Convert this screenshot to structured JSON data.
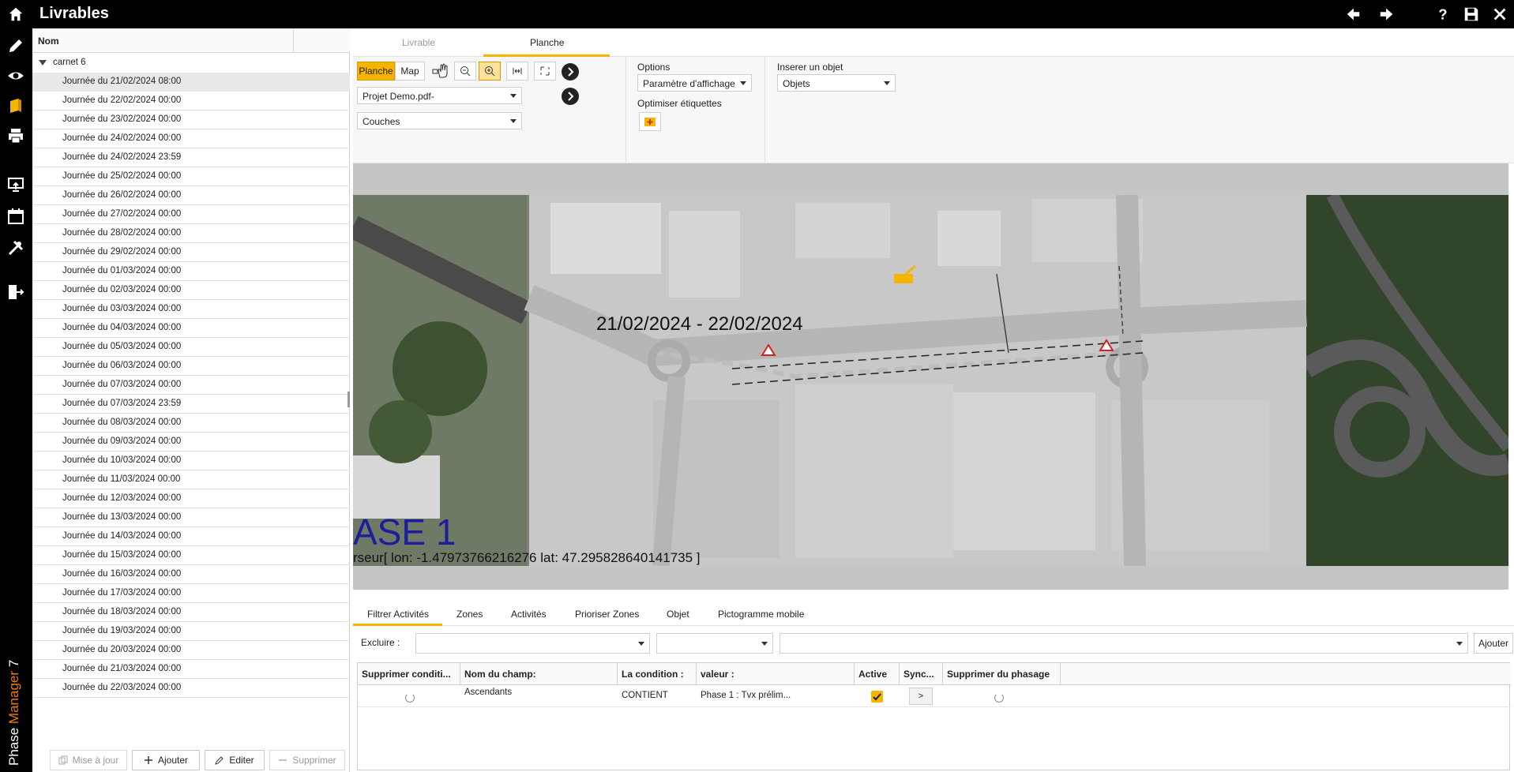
{
  "app": {
    "title": "Livrables",
    "brand_first": "Phase",
    "brand_accent": "Manager",
    "brand_version": "7",
    "accent_color": "#f5b400",
    "brand_color": "#f07a10"
  },
  "topbar_icons": [
    "home-icon",
    "arrow-left-icon",
    "arrow-right-icon",
    "help-icon",
    "save-icon",
    "close-icon"
  ],
  "leftnav_icons": [
    "pencil-icon",
    "eye-icon",
    "book-icon",
    "printer-icon",
    "monitor-upload-icon",
    "calendar-icon",
    "tools-icon",
    "logout-icon"
  ],
  "list": {
    "header": "Nom",
    "group": "carnet 6",
    "rows": [
      "Journée du 21/02/2024 08:00",
      "Journée du 22/02/2024 00:00",
      "Journée du 23/02/2024 00:00",
      "Journée du 24/02/2024 00:00",
      "Journée du 24/02/2024 23:59",
      "Journée du 25/02/2024 00:00",
      "Journée du 26/02/2024 00:00",
      "Journée du 27/02/2024 00:00",
      "Journée du 28/02/2024 00:00",
      "Journée du 29/02/2024 00:00",
      "Journée du 01/03/2024 00:00",
      "Journée du 02/03/2024 00:00",
      "Journée du 03/03/2024 00:00",
      "Journée du 04/03/2024 00:00",
      "Journée du 05/03/2024 00:00",
      "Journée du 06/03/2024 00:00",
      "Journée du 07/03/2024 00:00",
      "Journée du 07/03/2024 23:59",
      "Journée du 08/03/2024 00:00",
      "Journée du 09/03/2024 00:00",
      "Journée du 10/03/2024 00:00",
      "Journée du 11/03/2024 00:00",
      "Journée du 12/03/2024 00:00",
      "Journée du 13/03/2024 00:00",
      "Journée du 14/03/2024 00:00",
      "Journée du 15/03/2024 00:00",
      "Journée du 16/03/2024 00:00",
      "Journée du 17/03/2024 00:00",
      "Journée du 18/03/2024 00:00",
      "Journée du 19/03/2024 00:00",
      "Journée du 20/03/2024 00:00",
      "Journée du 21/03/2024 00:00",
      "Journée du 22/03/2024 00:00"
    ],
    "footer": {
      "update": "Mise à jour",
      "add": "Ajouter",
      "edit": "Editer",
      "delete": "Supprimer"
    }
  },
  "tabs": {
    "livrable": "Livrable",
    "planche": "Planche"
  },
  "toolbar": {
    "planche": "Planche",
    "map": "Map",
    "project": "Projet Demo.pdf-",
    "layers": "Couches",
    "options_label": "Options",
    "options_value": "Paramètre d'affichage",
    "optimise_label": "Optimiser étiquettes",
    "insert_label": "Inserer un objet",
    "insert_value": "Objets"
  },
  "map": {
    "date_range": "21/02/2024  - 22/02/2024",
    "phase_text": "ASE 1",
    "coords_text": "rseur[ lon: -1.47973766216276 lat: 47.295828640141735 ]"
  },
  "bottom_tabs": [
    "Filtrer Activités",
    "Zones",
    "Activités",
    "Prioriser Zones",
    "Objet",
    "Pictogramme mobile"
  ],
  "filter": {
    "exclude_label": "Excluire :",
    "add_button": "Ajouter"
  },
  "grid": {
    "headers": [
      "Supprimer conditi...",
      "Nom du champ:",
      "La condition :",
      "valeur :",
      "Active",
      "Sync...",
      "Supprimer du phasage"
    ],
    "row": {
      "field": "Ascendants",
      "condition": "CONTIENT",
      "value": "Phase 1 : Tvx prélim...",
      "active": true,
      "sync": ">"
    }
  }
}
